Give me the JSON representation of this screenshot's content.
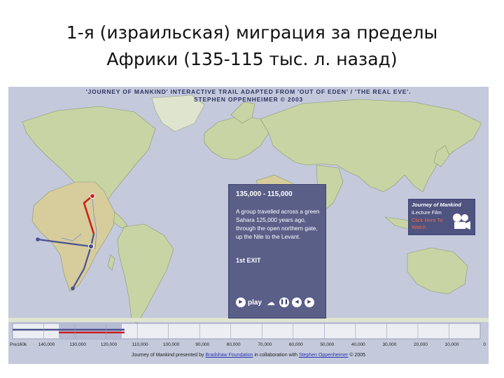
{
  "slide": {
    "title_line1": "1-я (израильская) миграция за пределы",
    "title_line2": "Африки (135-115 тыс. л. назад)"
  },
  "map": {
    "header_line1": "'JOURNEY OF MANKIND' INTERACTIVE TRAIL ADAPTED FROM 'OUT OF EDEN' / 'THE REAL EVE'.",
    "header_line2": "STEPHEN OPPENHEIMER © 2003",
    "colors": {
      "ocean": "#c4c9dc",
      "land": "#c8d4a4",
      "route_red": "#cc2020",
      "route_blue": "#4a5290",
      "panel": "#5a5f88"
    }
  },
  "info": {
    "date_range": "135,000 - 115,000",
    "text": "A group travelled across a green Sahara 125,000 years ago, through the open northern gate, up the Nile to the Levant.",
    "exit_label": "1st EXIT",
    "play_label": "play"
  },
  "film": {
    "title": "Journey of Mankind",
    "subtitle": "iLecture Film",
    "click_label": "Click Here To Watch"
  },
  "timeline": {
    "ticks": [
      "Pre160k",
      "140,000",
      "130,000",
      "120,000",
      "110,000",
      "100,000",
      "90,000",
      "80,000",
      "70,000",
      "60,000",
      "50,000",
      "40,000",
      "30,000",
      "20,000",
      "10,000",
      "0"
    ],
    "progress": 0.24
  },
  "credit": {
    "prefix": "Journey of Mankind presented by",
    "org": "Bradshaw Foundation",
    "middle": "in collaboration with",
    "author": "Stephen Oppenheimer",
    "suffix": "© 2005"
  }
}
